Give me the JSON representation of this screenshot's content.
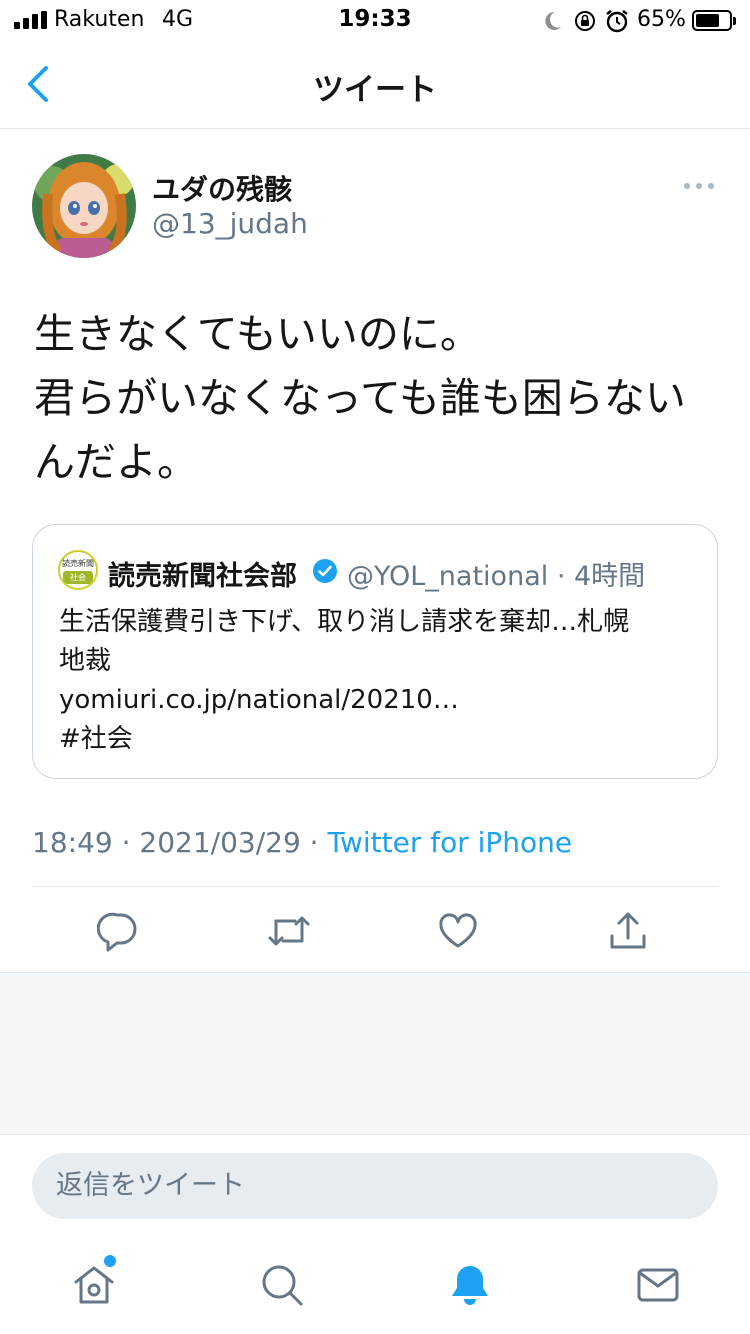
{
  "status_bar": {
    "carrier": "Rakuten",
    "network": "4G",
    "time": "19:33",
    "battery_percent": "65%",
    "battery_level": 0.65,
    "icons": [
      "signal-bars-icon",
      "moon-icon",
      "rotation-lock-icon",
      "alarm-clock-icon",
      "battery-icon"
    ]
  },
  "nav": {
    "title": "ツイート",
    "back_icon": "chevron-left-icon"
  },
  "tweet": {
    "display_name": "ユダの残骸",
    "handle": "@13_judah",
    "text_lines": [
      "生きなくてもいいのに。",
      "君らがいなくなっても誰も困らない",
      "んだよ。"
    ],
    "meta_time": "18:49 · 2021/03/29 · ",
    "meta_source": "Twitter for iPhone"
  },
  "quote": {
    "avatar_top": "読売新聞",
    "avatar_bottom": "社会",
    "name": "読売新聞社会部",
    "handle_time": "@YOL_national · 4時間",
    "text_lines": [
      "生活保護費引き下げ、取り消し請求を棄却…札幌",
      "地裁",
      "yomiuri.co.jp/national/20210…",
      "#社会"
    ]
  },
  "actions": [
    "reply-icon",
    "retweet-icon",
    "like-icon",
    "share-icon"
  ],
  "reply": {
    "placeholder": "返信をツイート"
  },
  "tab_bar": {
    "tabs": [
      "home-icon",
      "search-icon",
      "notifications-icon",
      "messages-icon"
    ]
  },
  "colors": {
    "accent": "#1da1f2",
    "text": "#14171a",
    "secondary": "#657786",
    "border": "#e1e8ed"
  }
}
